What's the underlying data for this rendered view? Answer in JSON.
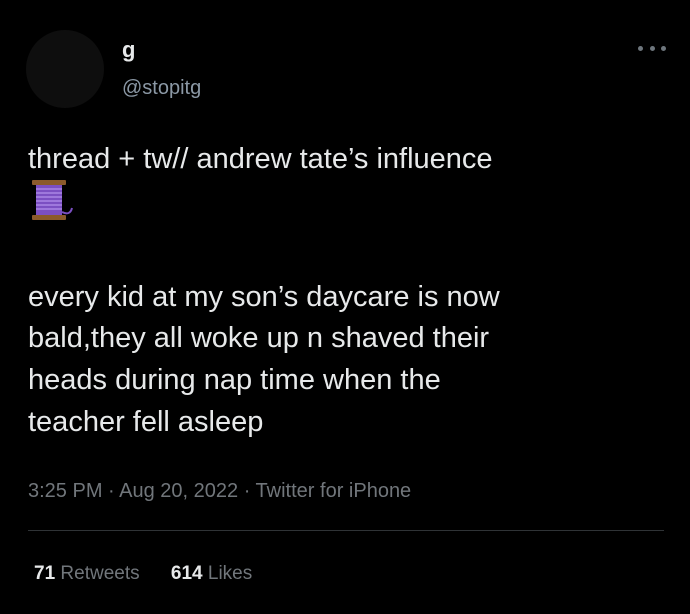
{
  "author": {
    "display_name": "g",
    "handle": "@stopitg"
  },
  "tweet": {
    "lines": [
      "thread + tw// andrew tate’s influence",
      "every kid  at my son’s daycare is now",
      "bald,they all woke up n shaved their",
      "heads during nap time when the",
      "teacher fell asleep"
    ],
    "emoji": "thread-spool-icon",
    "meta": "3:25 PM · Aug 20, 2022 · Twitter for iPhone"
  },
  "stats": {
    "retweets_count": "71",
    "retweets_label": "Retweets",
    "likes_count": "614",
    "likes_label": "Likes"
  },
  "colors": {
    "background": "#000000",
    "text": "#e7e9ea",
    "secondary": "#71767b",
    "spool": "#8a5cc7"
  }
}
